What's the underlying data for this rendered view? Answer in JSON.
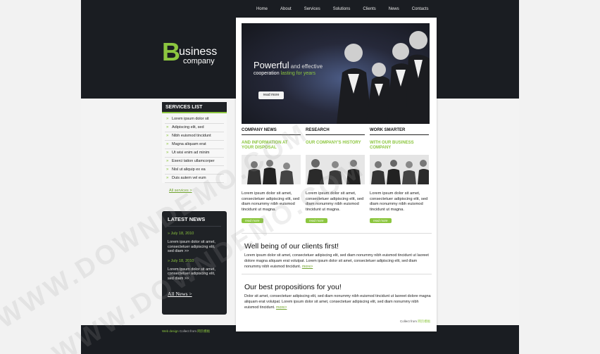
{
  "nav": [
    "Home",
    "About",
    "Services",
    "Solutions",
    "Clients",
    "News",
    "Contacts"
  ],
  "logo": {
    "letter": "B",
    "word1": "usiness",
    "word2": "company"
  },
  "services": {
    "title": "SERVICES LIST",
    "items": [
      "Lorem ipsum dolor sit",
      "Adipiscing elit, sed",
      "Nibh euismod tincidunt",
      "Magna aliquam erat",
      "Ut wisi enim ad minim",
      "Exerci tation ullamcorper",
      "Nisl ut aliquip ex ea",
      "Duis autem vel eum"
    ],
    "more": "All services >"
  },
  "news": {
    "title": "LATEST NEWS",
    "items": [
      {
        "date": "July 18, 2010",
        "text": "Lorem ipsum dolor sit amet, consectetuer adipiscing elit, sed diam >>"
      },
      {
        "date": "July 18, 2010",
        "text": "Lorem ipsum dolor sit amet, consectetuer adipiscing elit, sed diam >>"
      }
    ],
    "all": "All News >"
  },
  "hero": {
    "big": "Powerful",
    "small": " and effective",
    "line2a": "cooperation ",
    "line2b": "lasting for years",
    "button": "read more"
  },
  "columns": [
    {
      "head": "COMPANY NEWS",
      "sub": "AND INFORMATION AT YOUR DISPOSAL",
      "body": "Lorem ipsum dolor sit amet, consectetuer adipiscing elit, sed diam nonummy nibh euismod tincidunt ut magna.",
      "button": "read more"
    },
    {
      "head": "RESEARCH",
      "sub": "OUR COMPANY'S HISTORY",
      "body": "Lorem ipsum dolor sit amet, consectetuer adipiscing elit, sed diam nonummy nibh euismod tincidunt ut magna.",
      "button": "read more"
    },
    {
      "head": "WORK SMARTER",
      "sub": "WITH OUR BUSINESS COMPANY",
      "body": "Lorem ipsum dolor sit amet, consectetuer adipiscing elit, sed diam nonummy nibh euismod tincidunt ut magna.",
      "button": "read more"
    }
  ],
  "block1": {
    "title": "Well being of our clients first!",
    "text": "Lorem ipsum dolor sit amet, consectetuer adipiscing elit, sed diam nonummy nibh euismod tincidunt ut laoreet dolore magna aliquam erat volutpat. Lorem ipsum dolor sit amet, consectetuer adipiscing elit, sed diam nonummy nibh euismod tincidunt.",
    "more": "more>"
  },
  "block2": {
    "title": "Our best propositions for you!",
    "text": "Dolor sit amet, consectetuer adipiscing elit, sed diam nonummy nibh euismod tincidunt ut laoreet dolore magna aliquam erat volutpat. Lorem ipsum dolor sit amet, consectetuer adipiscing elit, sed diam nonummy nibh euismod tincidunt.",
    "more": "more>"
  },
  "footer": {
    "left_a": "Web design",
    "left_b": " Collect from ",
    "left_c": "网页模板",
    "right_a": "Collect from ",
    "right_b": "网页模板"
  },
  "watermark": "WWW.DOWNDEMO.COM",
  "colors": {
    "accent": "#8cc63f",
    "dark": "#1a1d22"
  }
}
